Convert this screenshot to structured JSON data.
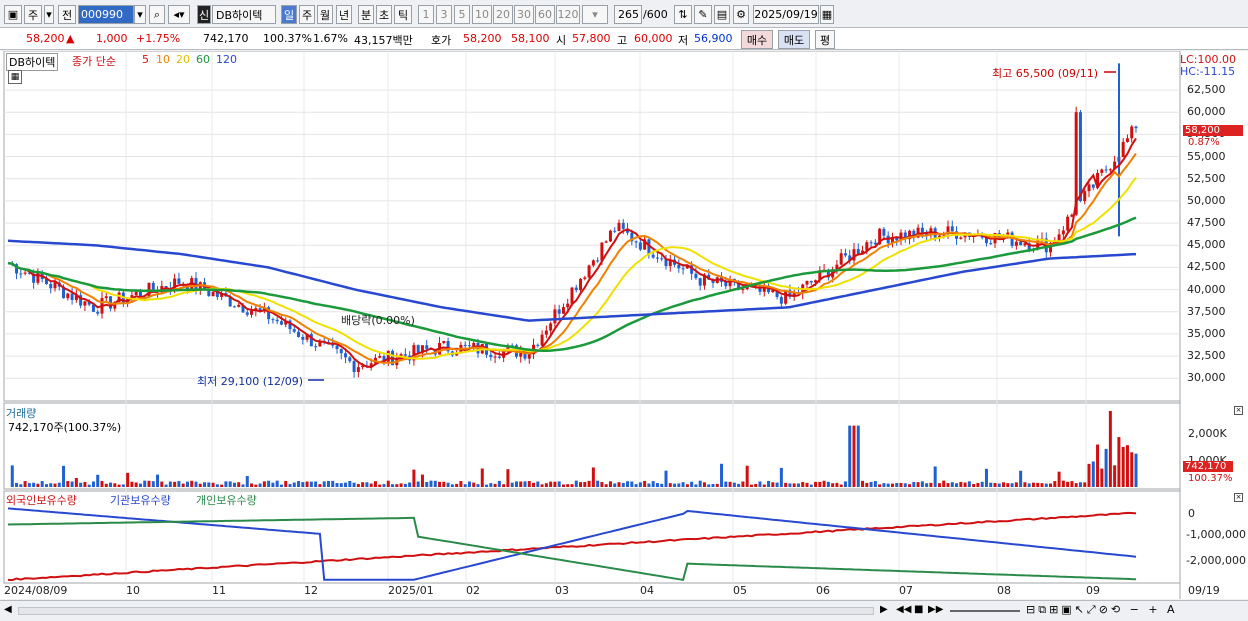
{
  "toolbar": {
    "period_main": "주",
    "jeon": "전",
    "code": "000990",
    "sin": "신",
    "stock_name": "DB하이텍",
    "periods": [
      "일",
      "주",
      "월",
      "년",
      "분",
      "초",
      "틱"
    ],
    "minutes": [
      "1",
      "3",
      "5",
      "10",
      "20",
      "30",
      "60",
      "120"
    ],
    "count": "265",
    "count_total": "/600",
    "date": "2025/09/19"
  },
  "info": {
    "price": "58,200",
    "change": "1,000",
    "change_pct": "+1.75%",
    "volume": "742,170",
    "vol_ratio": "100.37%",
    "turnover_pct": "1.67%",
    "amount": "43,157백만",
    "bid_label": "호가",
    "bid1": "58,200",
    "bid2": "58,100",
    "open_label": "시",
    "open": "57,800",
    "high_label": "고",
    "high": "60,000",
    "low_label": "저",
    "low": "56,900",
    "buy_btn": "매수",
    "sell_btn": "매도",
    "eval_btn": "평"
  },
  "price_pane": {
    "name_tag": "DB하이텍",
    "ma_label": "종가 단순",
    "ma_periods": [
      "5",
      "10",
      "20",
      "60",
      "120"
    ],
    "ma_colors": [
      "#d01010",
      "#f08000",
      "#f0e000",
      "#1a9a3a",
      "#2848d0"
    ],
    "lc": "LC:100.00",
    "hc": "HC:-11.15",
    "high_note": "최고 65,500 (09/11)",
    "low_note": "최저 29,100 (12/09)",
    "dividend_note": "배당락(0.00%)",
    "current_tag": "58,200",
    "current_pct": "0.87%",
    "yticks": [
      "62,500",
      "60,000",
      "57,500",
      "55,000",
      "52,500",
      "50,000",
      "47,500",
      "45,000",
      "42,500",
      "40,000",
      "37,500",
      "35,000",
      "32,500",
      "30,000"
    ]
  },
  "volume_pane": {
    "title": "거래량",
    "value": "742,170주(100.37%)",
    "yticks": [
      "2,000K",
      "1,000K"
    ],
    "current_tag": "742,170",
    "current_pct": "100.37%"
  },
  "holding_pane": {
    "legend": [
      "외국인보유수량",
      "기관보유수량",
      "개인보유수량"
    ],
    "colors": [
      "#d01010",
      "#2848d0",
      "#2a8a4a"
    ],
    "yticks": [
      "0",
      "-1,000,000",
      "-2,000,000"
    ]
  },
  "xaxis": {
    "labels": [
      "2024/08/09",
      "10",
      "11",
      "12",
      "2025/01",
      "02",
      "03",
      "04",
      "05",
      "06",
      "07",
      "08",
      "09"
    ],
    "end_label": "09/19"
  },
  "chart_data": {
    "type": "line",
    "title": "DB하이텍",
    "ylim": [
      28000,
      66000
    ],
    "x": [
      "2024/08",
      "2024/09",
      "2024/10",
      "2024/11",
      "2024/12",
      "2025/01",
      "2025/02",
      "2025/03",
      "2025/04",
      "2025/05",
      "2025/06",
      "2025/07",
      "2025/08",
      "2025/09"
    ],
    "series": [
      {
        "name": "종가",
        "values": [
          43000,
          38000,
          41000,
          37000,
          31500,
          33500,
          33000,
          47000,
          41000,
          39000,
          46000,
          46500,
          45000,
          58200
        ]
      },
      {
        "name": "120",
        "values": [
          45500,
          45000,
          44000,
          42500,
          40000,
          38000,
          36500,
          37000,
          37500,
          38000,
          40000,
          42000,
          43500,
          44000
        ]
      }
    ]
  }
}
